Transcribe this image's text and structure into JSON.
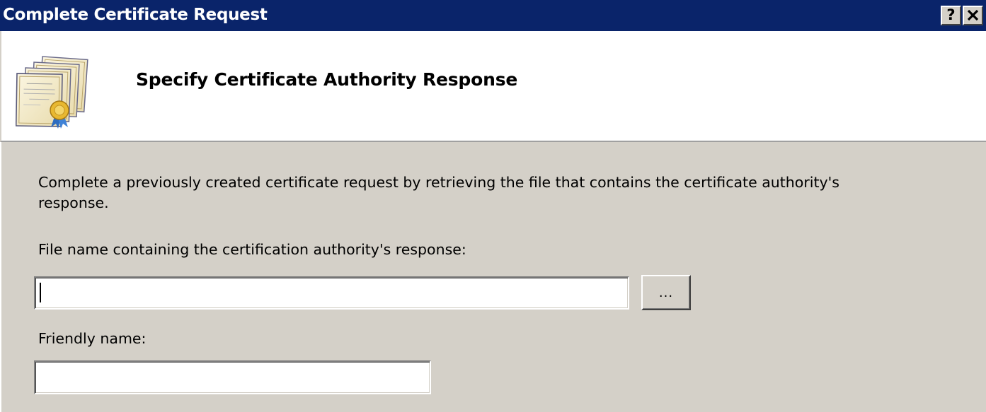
{
  "window": {
    "title": "Complete Certificate Request",
    "help_label": "?",
    "close_label": "✕"
  },
  "header": {
    "title": "Specify Certificate Authority Response",
    "icon": "certificate-icon"
  },
  "body": {
    "description": "Complete a previously created certificate request by retrieving the file that contains the certificate authority's response.",
    "file_label": "File name containing the certification authority's response:",
    "file_value": "",
    "browse_label": "...",
    "friendly_label": "Friendly name:",
    "friendly_value": ""
  },
  "colors": {
    "titlebar": "#0a246a",
    "face": "#d4d0c8",
    "header_bg": "#ffffff"
  }
}
